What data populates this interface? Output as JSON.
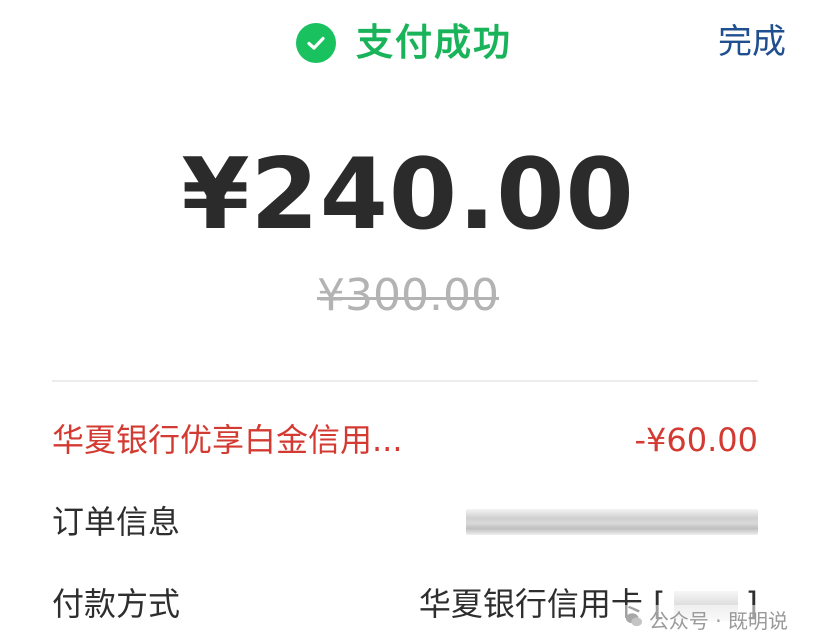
{
  "header": {
    "status_title": "支付成功",
    "done_label": "完成"
  },
  "payment": {
    "amount": "¥240.00",
    "original_amount": "¥300.00"
  },
  "details": {
    "discount_label": "华夏银行优享白金信用...",
    "discount_value": "-¥60.00",
    "order_label": "订单信息",
    "method_label": "付款方式",
    "method_value_prefix": "华夏银行信用卡 [",
    "method_value_suffix": "]"
  },
  "watermark": {
    "text": "公众号 · 既明说"
  },
  "colors": {
    "success": "#19c15f",
    "link": "#1f4f8f",
    "discount": "#d33a32",
    "amount": "#2b2b2b",
    "strikethrough": "#b3b3b3"
  },
  "icons": {
    "status": "check-circle-icon",
    "watermark": "wechat-icon"
  }
}
